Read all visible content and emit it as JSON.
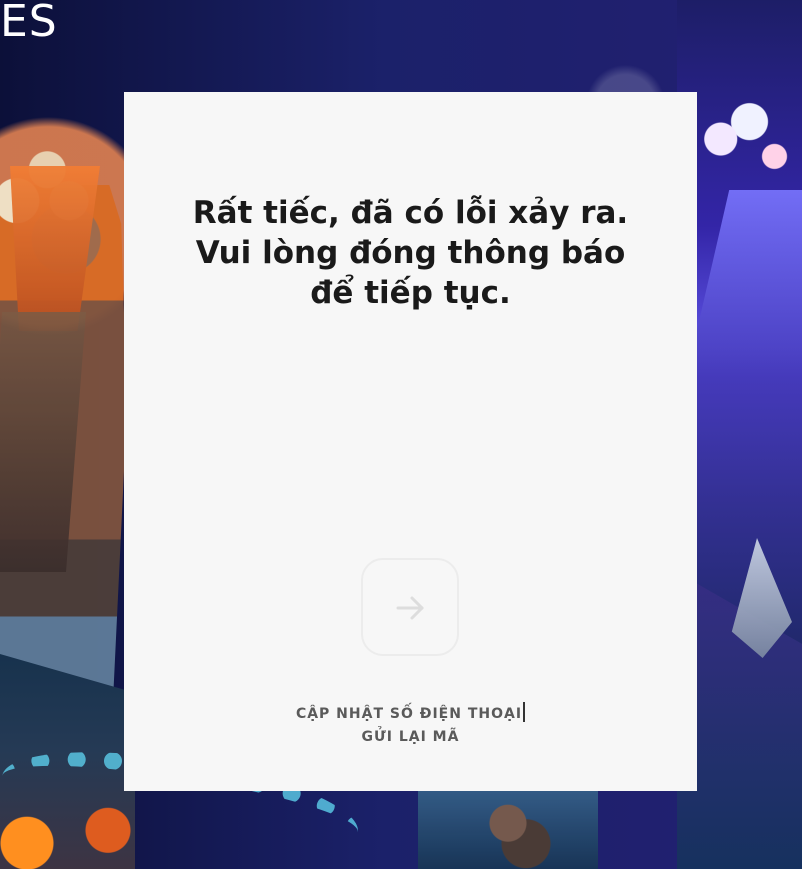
{
  "brand": {
    "text": "ES"
  },
  "modal": {
    "message": "Rất tiếc, đã có lỗi xảy ra.\nVui lòng đóng thông báo\nđể tiếp tục.",
    "links": [
      {
        "label": "CẬP NHẬT SỐ ĐIỆN THOẠI"
      },
      {
        "label": "GỬI LẠI MÃ"
      }
    ]
  },
  "icons": {
    "arrow": "arrow-right-icon"
  },
  "colors": {
    "modal_background": "#f7f7f7",
    "text_primary": "#1a1a1a",
    "link_text": "#5a5a5a",
    "button_border": "#ececec",
    "arrow_color": "#dddddd"
  }
}
